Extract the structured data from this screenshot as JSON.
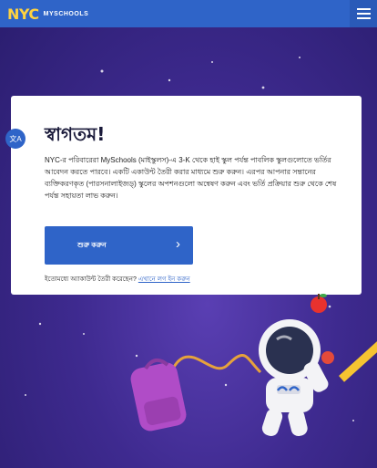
{
  "header": {
    "logo_nyc": "NYC",
    "logo_sub": "MYSCHOOLS",
    "menu_icon": "hamburger-menu-icon"
  },
  "card": {
    "translate_icon": "translate-icon",
    "title": "স্বাগতম!",
    "description": "NYC-র পরিবারেরা MySchools (মাইস্কুলস)-এ 3-K থেকে হাই স্কুল পর্যন্ত পাবলিক স্কুলগুলোতে ভর্তির আবেদন করতে পারবে। একটি একাউন্ট তৈরী করার মাধ্যমে শুরু করুন। এরপর আপনার সন্তানের ব্যক্তিকরণকৃত (পারসনালাইজড্‌) স্কুলের অপশনগুলো অন্বেষণ করুন এবং ভর্তি প্রক্রিয়ার শুরু থেকে শেষ পর্যন্ত সহায়তা লাভ করুন।",
    "start_button": "শুরু করুন",
    "start_chevron_icon": "chevron-right-icon",
    "signin_prefix": "ইতোমধ্যে অ্যাকাউন্ট তৈরী করেছেন?",
    "signin_link": "এখানে লগ ইন করুন"
  },
  "colors": {
    "header_bg": "#2f64c8",
    "logo_yellow": "#ffd23f",
    "button_blue": "#2f64c8",
    "space_purple": "#3e2a8f"
  }
}
